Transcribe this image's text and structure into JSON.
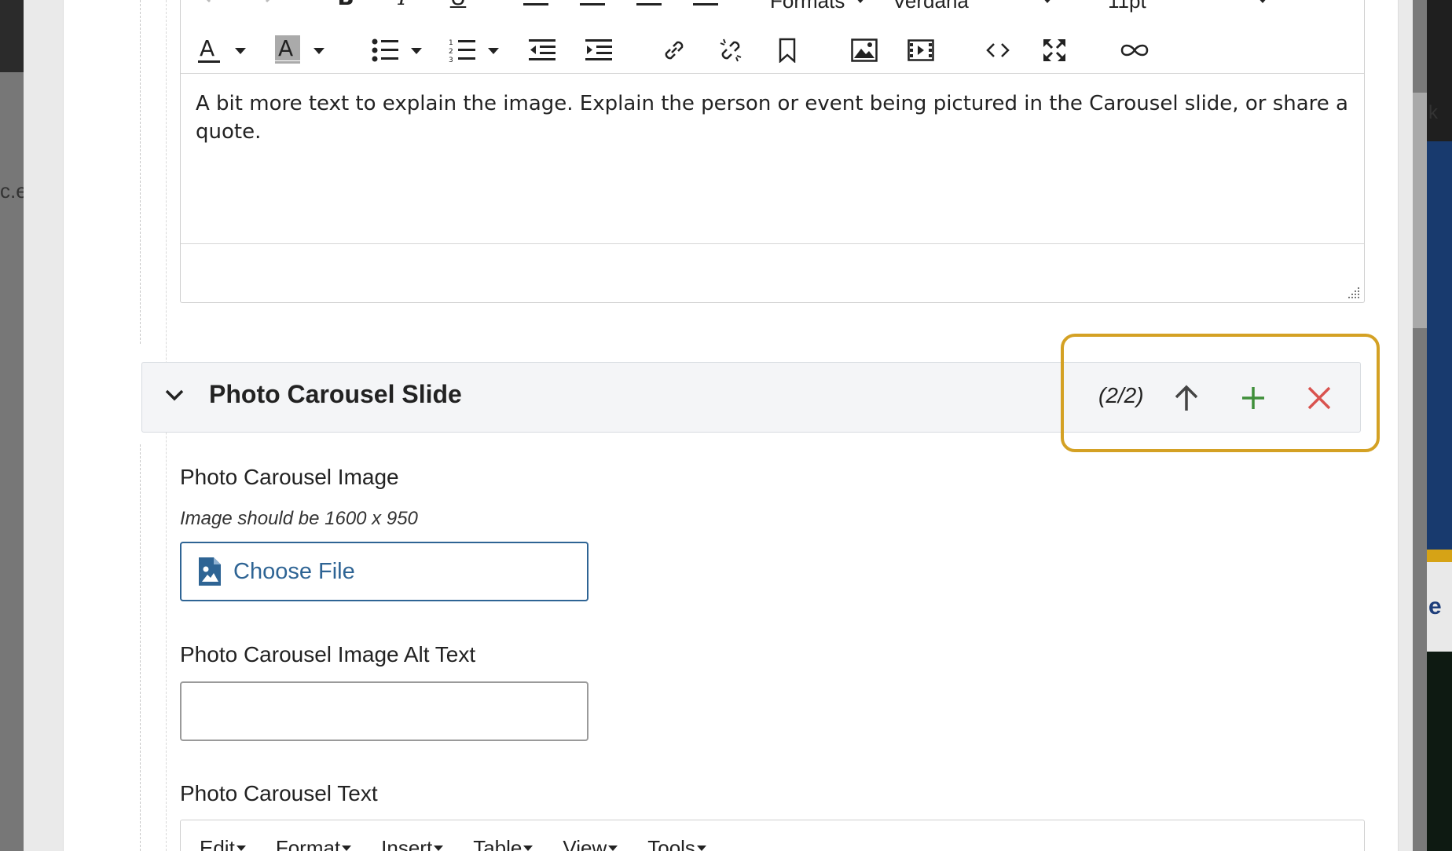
{
  "background": {
    "left_fragment": "c.e",
    "right_fragment_top": "k",
    "right_fragment_bottom": "e"
  },
  "editor": {
    "toolbar": {
      "formats_label": "Formats",
      "font_family": "Verdana",
      "font_size": "11pt",
      "icons": [
        "undo-icon",
        "redo-icon",
        "bold-icon",
        "italic-icon",
        "underline-icon",
        "align-left-icon",
        "align-center-icon",
        "align-right-icon",
        "align-justify-icon",
        "text-color-icon",
        "highlight-color-icon",
        "bullet-list-icon",
        "numbered-list-icon",
        "outdent-icon",
        "indent-icon",
        "link-icon",
        "unlink-icon",
        "bookmark-icon",
        "image-icon",
        "video-icon",
        "source-code-icon",
        "fullscreen-icon",
        "embed-icon"
      ]
    },
    "content": "A bit more text to explain the image. Explain the person or event being pictured in the Carousel slide, or share a quote."
  },
  "slide": {
    "title": "Photo Carousel Slide",
    "counter": "(2/2)",
    "colors": {
      "move_up": "#444444",
      "add": "#3f8f3a",
      "remove": "#d9534f",
      "highlight": "#d4a124"
    }
  },
  "fields": {
    "image_label": "Photo Carousel Image",
    "image_help": "Image should be 1600 x 950",
    "choose_file_label": "Choose File",
    "alt_text_label": "Photo Carousel Image Alt Text",
    "alt_text_value": "",
    "text_label": "Photo Carousel Text"
  },
  "editor2": {
    "menu": [
      "Edit",
      "Format",
      "Insert",
      "Table",
      "View",
      "Tools"
    ]
  }
}
